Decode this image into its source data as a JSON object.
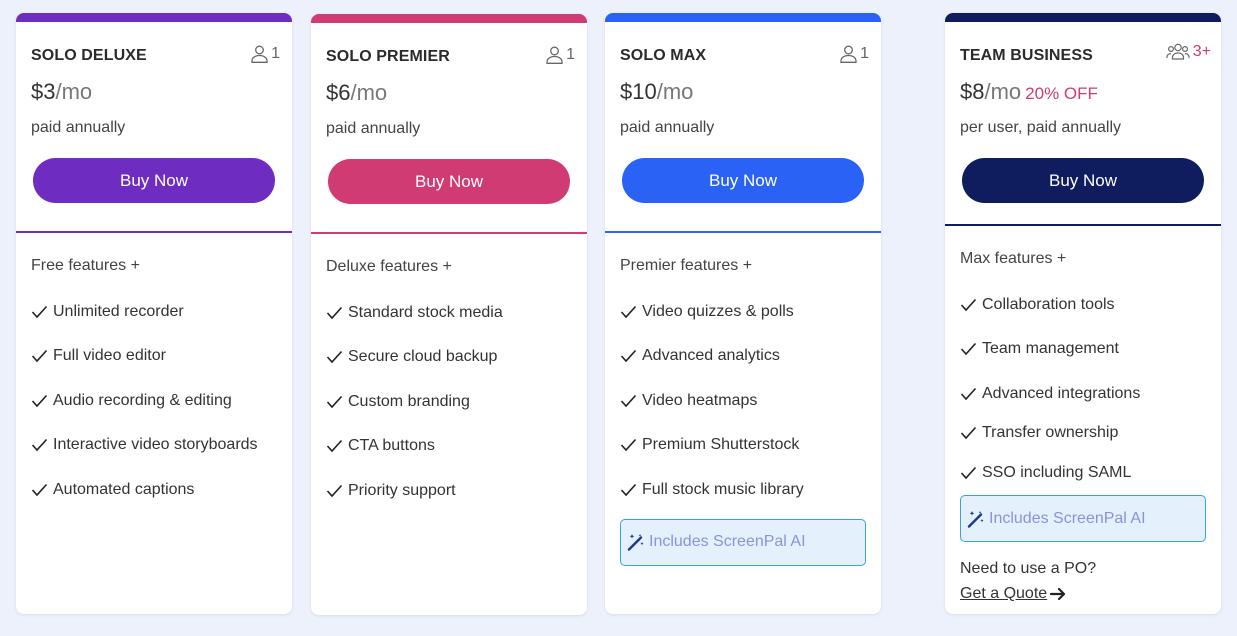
{
  "plans": [
    {
      "name": "SOLO DELUXE",
      "seats": "1",
      "seat_icon": "user-icon",
      "price_amount": "$3",
      "price_period": "/mo",
      "billing": "paid annually",
      "button_label": "Buy Now",
      "accent_color": "#6e2dc0",
      "features_title": "Free features +",
      "features": [
        "Unlimited recorder",
        "Full video editor",
        "Audio recording & editing",
        "Interactive video storyboards",
        "Automated captions"
      ]
    },
    {
      "name": "SOLO PREMIER",
      "seats": "1",
      "seat_icon": "user-icon",
      "price_amount": "$6",
      "price_period": "/mo",
      "billing": "paid annually",
      "button_label": "Buy Now",
      "accent_color": "#cf3b72",
      "features_title": "Deluxe features +",
      "features": [
        "Standard stock media",
        "Secure cloud backup",
        "Custom branding",
        "CTA buttons",
        "Priority support"
      ]
    },
    {
      "name": "SOLO MAX",
      "seats": "1",
      "seat_icon": "user-icon",
      "price_amount": "$10",
      "price_period": "/mo",
      "billing": "paid annually",
      "button_label": "Buy Now",
      "accent_color": "#2962f5",
      "features_title": "Premier features +",
      "features": [
        "Video quizzes & polls",
        "Advanced analytics",
        "Video heatmaps",
        "Premium Shutterstock",
        "Full stock music library"
      ],
      "ai_label": "Includes ScreenPal AI",
      "ai_icon": "magic-wand-icon"
    },
    {
      "name": "TEAM BUSINESS",
      "seats": "3+",
      "seat_icon": "users-group-icon",
      "seat_color": "#cf3b72",
      "price_amount": "$8",
      "price_period": "/mo",
      "discount": "20% OFF",
      "discount_color": "#cf3b72",
      "billing": "per user, paid annually",
      "button_label": "Buy Now",
      "accent_color": "#0f1c5e",
      "features_title": "Max features +",
      "features": [
        "Collaboration tools",
        "Team management",
        "Advanced integrations",
        "Transfer ownership",
        "SSO including SAML"
      ],
      "ai_label": "Includes ScreenPal AI",
      "ai_icon": "magic-wand-icon",
      "po_text": "Need to use a PO?",
      "quote_label": "Get a Quote",
      "quote_icon": "arrow-right-icon"
    }
  ]
}
